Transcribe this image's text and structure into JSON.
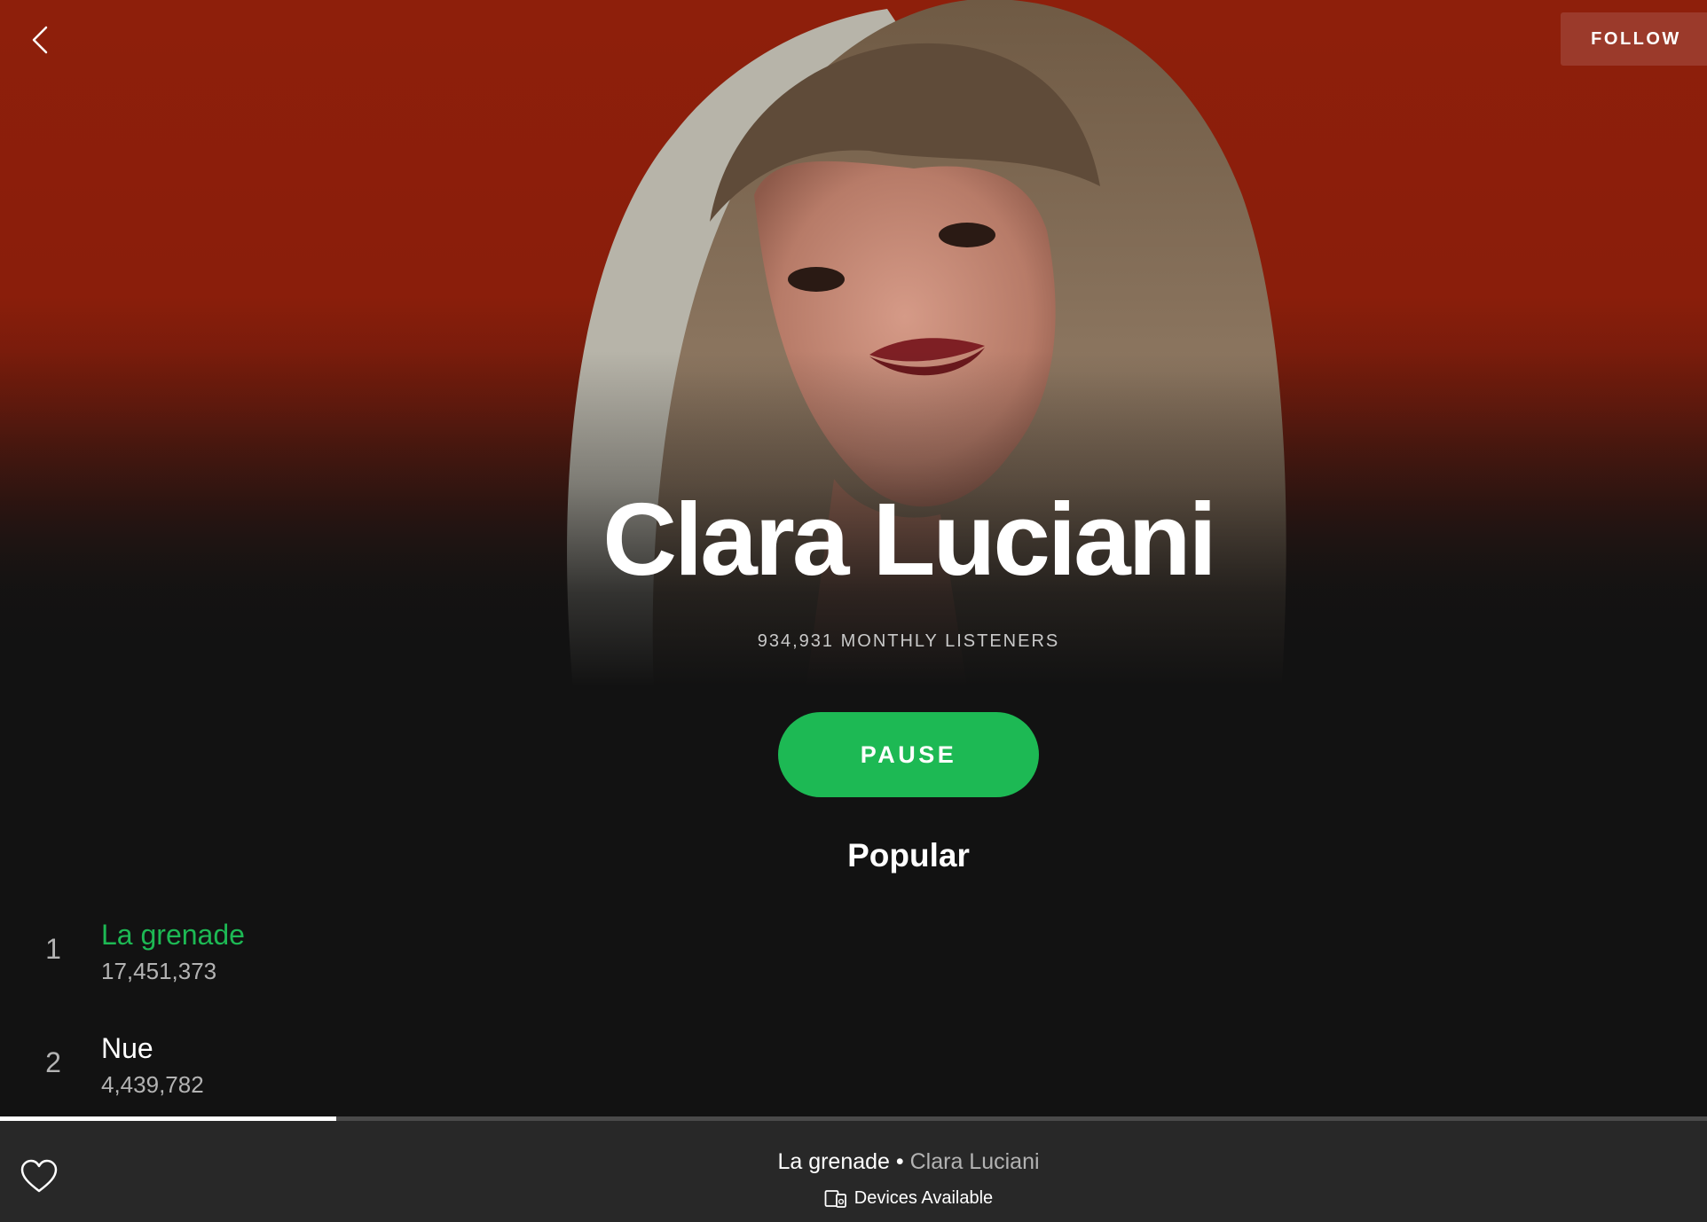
{
  "colors": {
    "hero_red": "#8e1f0b",
    "background": "#121212",
    "accent_green": "#1db954",
    "follow_button": "#9b3a2b",
    "player_bar": "#282828"
  },
  "header": {
    "back_icon": "chevron-left-icon",
    "follow_label": "FOLLOW"
  },
  "artist": {
    "name": "Clara Luciani",
    "monthly_listeners": "934,931 MONTHLY LISTENERS",
    "photo": "artist-portrait"
  },
  "actions": {
    "pause_label": "PAUSE"
  },
  "popular": {
    "title": "Popular",
    "tracks": [
      {
        "rank": "1",
        "title": "La grenade",
        "plays": "17,451,373",
        "playing": true
      },
      {
        "rank": "2",
        "title": "Nue",
        "plays": "4,439,782",
        "playing": false
      }
    ]
  },
  "player": {
    "progress": 0.197,
    "track": "La grenade",
    "separator": " • ",
    "artist": "Clara Luciani",
    "devices_label": "Devices Available",
    "heart_icon": "heart-icon",
    "devices_icon": "devices-icon"
  }
}
